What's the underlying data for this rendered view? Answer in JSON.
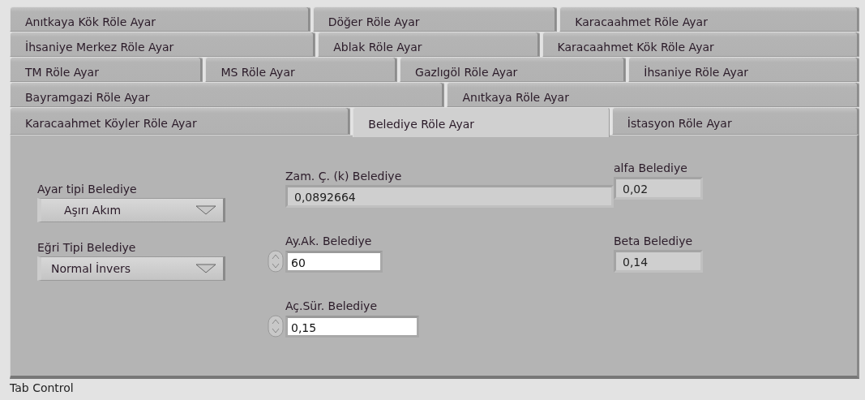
{
  "tab_rows": [
    [
      {
        "label": "Anıtkaya Kök Röle Ayar",
        "selected": false
      },
      {
        "label": "Döğer Röle Ayar",
        "selected": false
      },
      {
        "label": "Karacaahmet Röle Ayar",
        "selected": false
      }
    ],
    [
      {
        "label": "İhsaniye Merkez Röle Ayar",
        "selected": false
      },
      {
        "label": "Ablak Röle Ayar",
        "selected": false
      },
      {
        "label": "Karacaahmet Kök Röle Ayar",
        "selected": false
      }
    ],
    [
      {
        "label": "TM Röle Ayar",
        "selected": false
      },
      {
        "label": "MS Röle Ayar",
        "selected": false
      },
      {
        "label": "Gazlıgöl Röle Ayar",
        "selected": false
      },
      {
        "label": "İhsaniye Röle Ayar",
        "selected": false
      }
    ],
    [
      {
        "label": "Bayramgazi Röle Ayar",
        "selected": false
      },
      {
        "label": "Anıtkaya Röle Ayar",
        "selected": false
      }
    ],
    [
      {
        "label": "Karacaahmet Köyler Röle Ayar",
        "selected": false
      },
      {
        "label": "Belediye Röle Ayar",
        "selected": true
      },
      {
        "label": "İstasyon Röle Ayar",
        "selected": false
      }
    ]
  ],
  "columns": [
    [
      {
        "kind": "ring",
        "label": "Ayar tipi Belediye",
        "value": "Aşırı Akım"
      },
      {
        "kind": "ring",
        "label": "Eğri Tipi Belediye",
        "value": "Normal İnvers"
      }
    ],
    [
      {
        "kind": "indicator",
        "label": "Zam. Ç. (k) Belediye",
        "value": "0,0892664"
      },
      {
        "kind": "control",
        "label": "Ay.Ak. Belediye",
        "value": "60"
      },
      {
        "kind": "control",
        "label": "Aç.Sür. Belediye",
        "value": "0,15"
      }
    ],
    [
      {
        "kind": "indicator",
        "label": "alfa Belediye",
        "value": "0,02"
      },
      {
        "kind": "indicator",
        "label": "Beta Belediye",
        "value": "0,14"
      }
    ]
  ],
  "status_bar": "Tab Control"
}
